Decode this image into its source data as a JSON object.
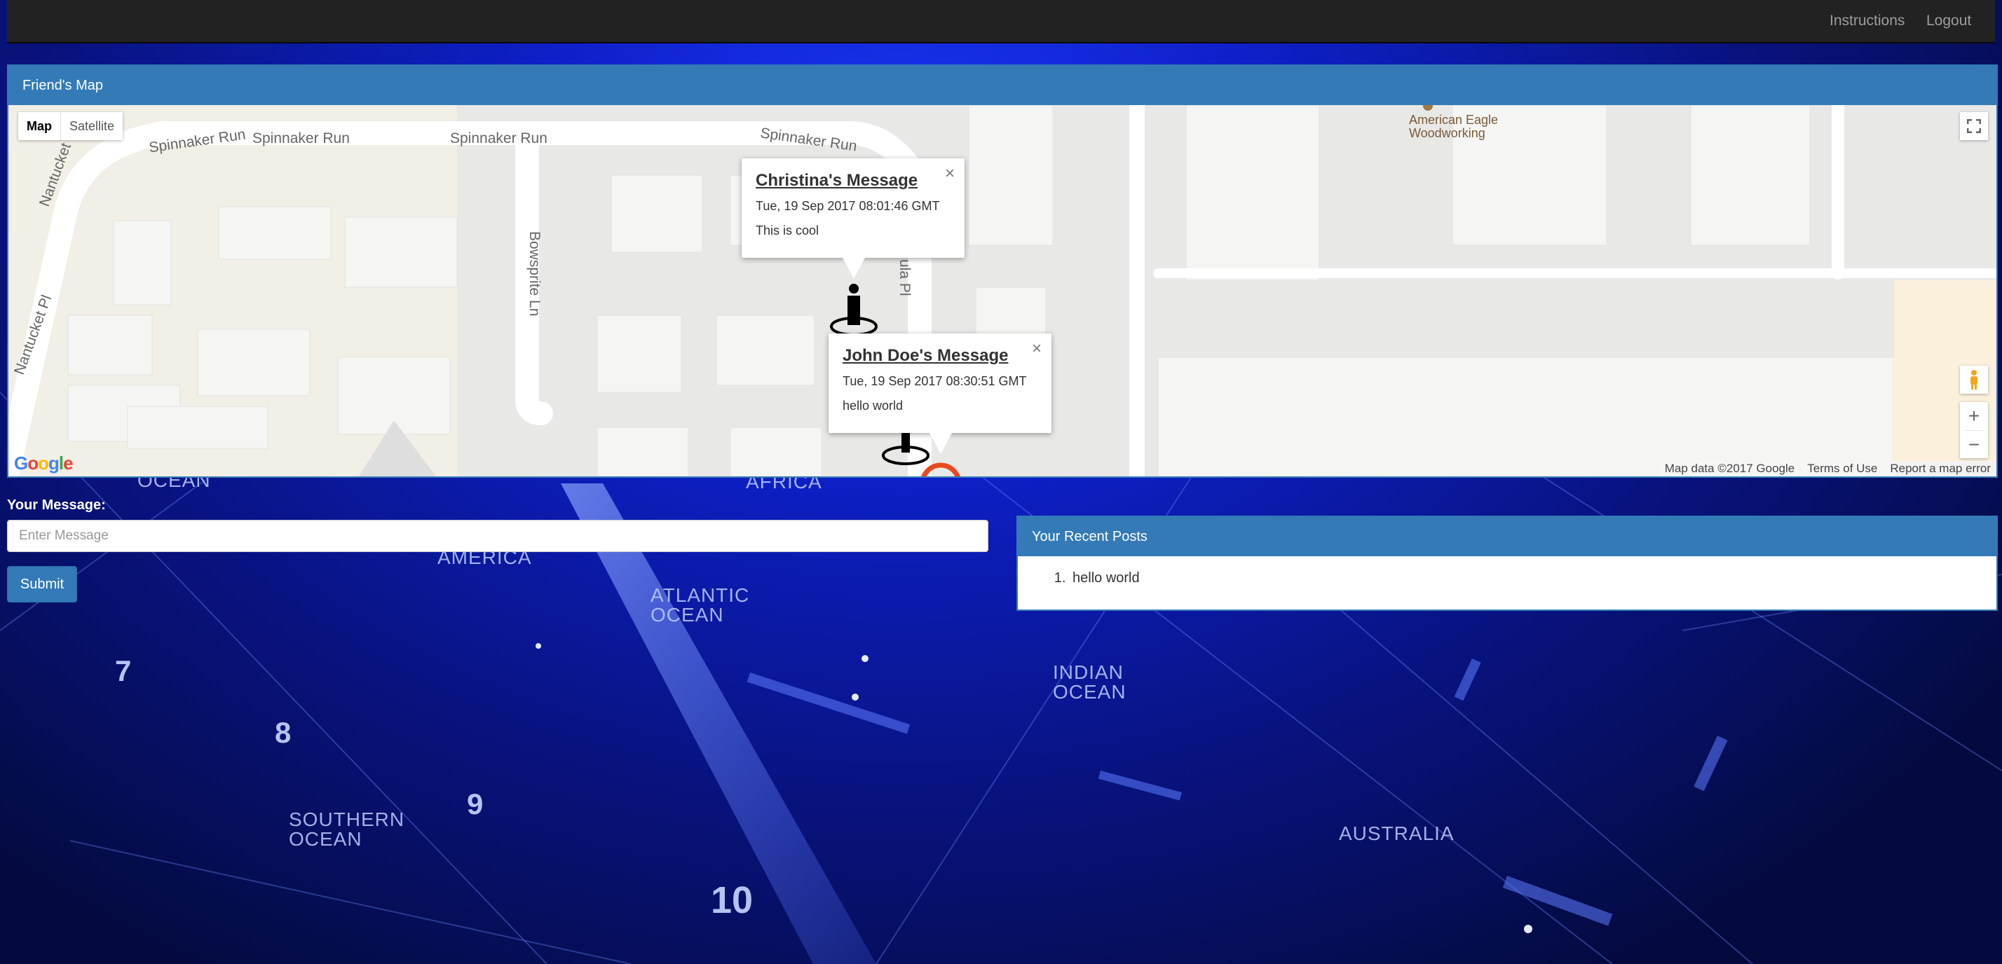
{
  "navbar": {
    "links": [
      "Instructions",
      "Logout"
    ]
  },
  "friends_map": {
    "title": "Friend's Map",
    "map_type_buttons": [
      "Map",
      "Satellite"
    ],
    "street_labels": [
      "Spinnaker Run",
      "Spinnaker Run",
      "Spinnaker Run",
      "Spinnaker Run",
      "Nantucket Pl",
      "Nantucket Pl",
      "Bowsprite Ln",
      "ula Pl"
    ],
    "poi": "American Eagle Woodworking",
    "google_logo": "Google",
    "attribution": {
      "map_data": "Map data ©2017 Google",
      "terms": "Terms of Use",
      "report": "Report a map error"
    },
    "info_windows": [
      {
        "title": "Christina's Message",
        "date": "Tue, 19 Sep 2017 08:01:46 GMT",
        "message": "This is cool"
      },
      {
        "title": "John Doe's Message",
        "date": "Tue, 19 Sep 2017 08:30:51 GMT",
        "message": "hello world"
      }
    ],
    "close_glyph": "×"
  },
  "message_form": {
    "label": "Your Message:",
    "placeholder": "Enter Message",
    "submit_label": "Submit"
  },
  "recent_posts": {
    "title": "Your Recent Posts",
    "items": [
      "hello world"
    ]
  },
  "background_labels": {
    "ocean1": "OCEAN",
    "africa": "AFRICA",
    "america": "AMERICA",
    "atlantic": "ATLANTIC OCEAN",
    "indian": "INDIAN OCEAN",
    "southern": "SOUTHERN OCEAN",
    "australia": "AUSTRALIA",
    "n7": "7",
    "n8": "8",
    "n9": "9",
    "n10": "10"
  },
  "colors": {
    "primary": "#337ab7",
    "navbar": "#222222",
    "marker_ring": "#e8491d"
  }
}
